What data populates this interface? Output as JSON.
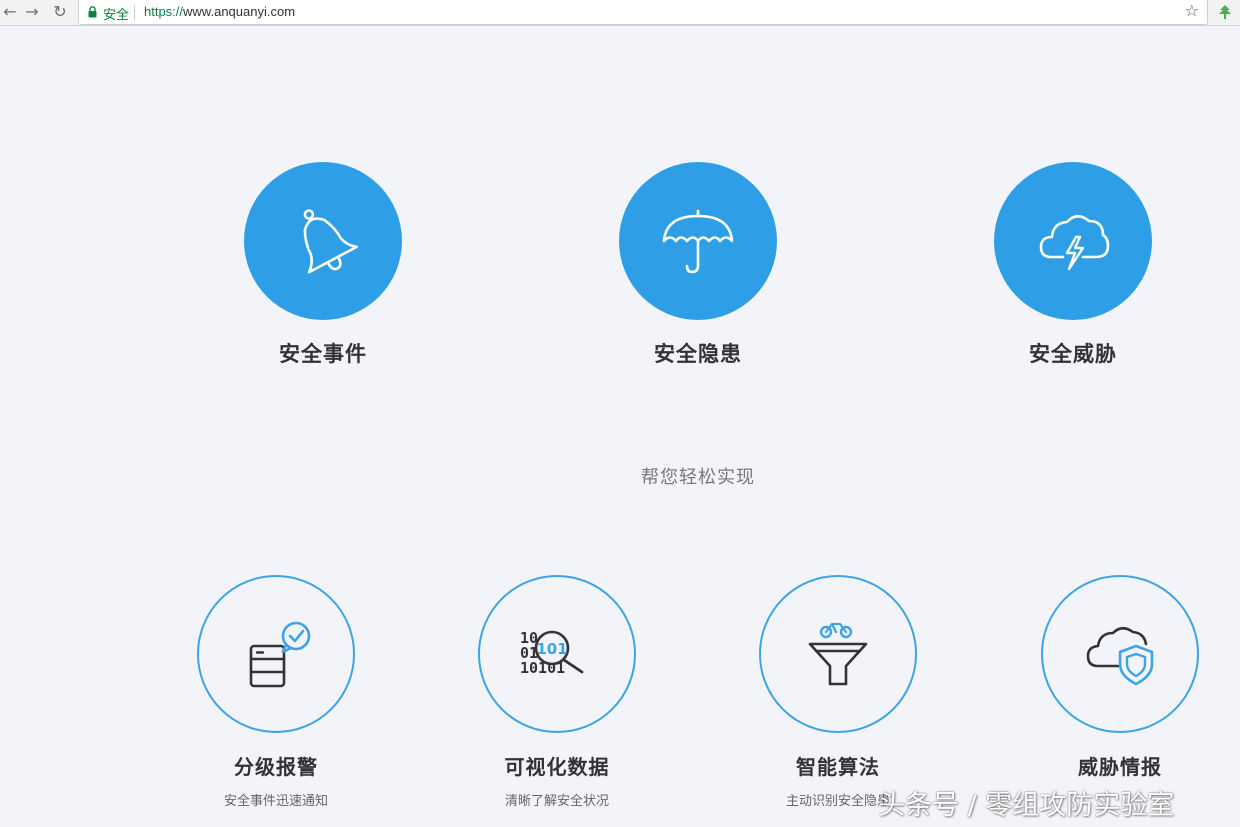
{
  "browser": {
    "secure_label": "安全",
    "url_scheme": "https://",
    "url_host": "www.anquanyi.com",
    "back_icon": "arrow-left",
    "forward_icon": "arrow-right",
    "reload_icon": "reload",
    "bookmark_icon": "star"
  },
  "features": [
    {
      "label": "安全事件",
      "icon": "bell-icon"
    },
    {
      "label": "安全隐患",
      "icon": "umbrella-icon"
    },
    {
      "label": "安全威胁",
      "icon": "cloud-lightning-icon"
    }
  ],
  "subtitle": "帮您轻松实现",
  "capabilities": [
    {
      "title": "分级报警",
      "desc": "安全事件迅速通知",
      "icon": "server-alert-icon"
    },
    {
      "title": "可视化数据",
      "desc": "清晰了解安全状况",
      "icon": "binary-search-icon"
    },
    {
      "title": "智能算法",
      "desc": "主动识别安全隐患",
      "icon": "funnel-icon"
    },
    {
      "title": "威胁情报",
      "desc": "",
      "icon": "cloud-shield-icon"
    }
  ],
  "watermark": "头条号 / 零组攻防实验室",
  "colors": {
    "accent": "#2e9fe6",
    "background": "#f3f4f9",
    "text": "#333333"
  }
}
